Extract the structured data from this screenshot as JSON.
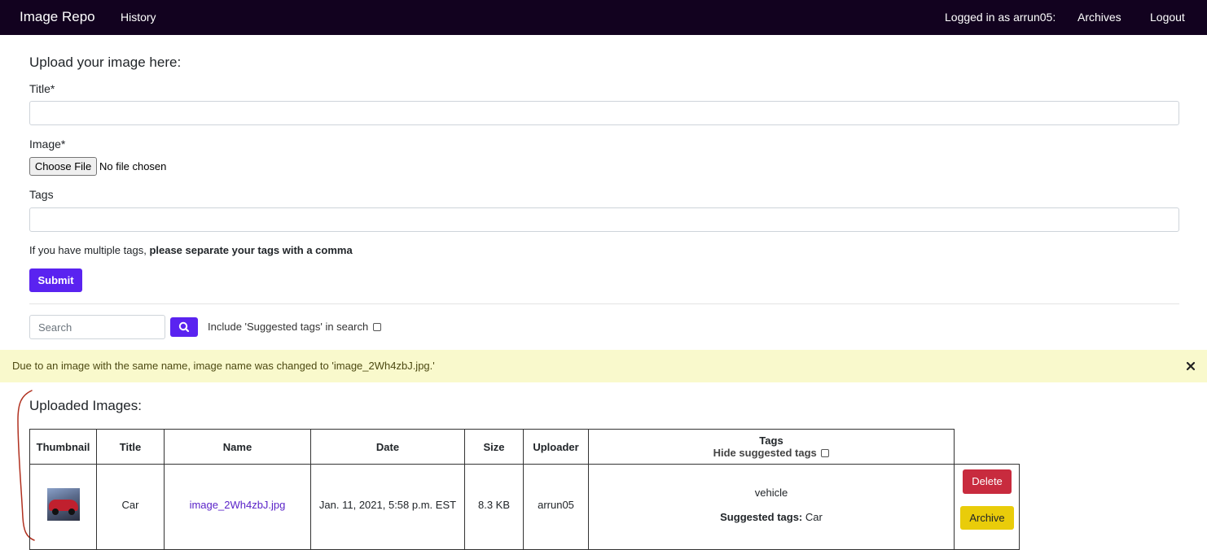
{
  "navbar": {
    "brand": "Image Repo",
    "history": "History",
    "logged_in": "Logged in as arrun05:",
    "archives": "Archives",
    "logout": "Logout",
    "background_color": "#12021f"
  },
  "upload_form": {
    "heading": "Upload your image here:",
    "title_label": "Title*",
    "title_value": "",
    "image_label": "Image*",
    "choose_file_button": "Choose File",
    "file_status": "No file chosen",
    "tags_label": "Tags",
    "tags_value": "",
    "hint_prefix": "If you have multiple tags,",
    "hint_bold": "please separate your tags with a comma",
    "submit_button": "Submit",
    "accent_color": "#5a23f0"
  },
  "search": {
    "placeholder": "Search",
    "button_icon": "search-icon",
    "include_suggested_label": "Include 'Suggested tags' in search",
    "include_suggested_checked": false
  },
  "alert": {
    "message": "Due to an image with the same name, image name was changed to 'image_2Wh4zbJ.jpg.'",
    "close_icon": "close-icon",
    "background_color": "#f9f9cc"
  },
  "uploaded": {
    "heading": "Uploaded Images:",
    "columns": {
      "thumbnail": "Thumbnail",
      "title": "Title",
      "name": "Name",
      "date": "Date",
      "size": "Size",
      "uploader": "Uploader",
      "tags": "Tags",
      "hide_suggested": "Hide suggested tags"
    },
    "hide_suggested_checked": false,
    "rows": [
      {
        "thumbnail_icon": "car-thumbnail",
        "title": "Car",
        "name": "image_2Wh4zbJ.jpg",
        "date": "Jan. 11, 2021, 5:58 p.m. EST",
        "size": "8.3 KB",
        "uploader": "arrun05",
        "tags": "vehicle",
        "suggested_label": "Suggested tags:",
        "suggested_value": "Car",
        "delete_button": "Delete",
        "archive_button": "Archive"
      }
    ]
  },
  "colors": {
    "delete": "#c82b3e",
    "archive": "#e9cc0a",
    "link": "#5a23c8"
  }
}
